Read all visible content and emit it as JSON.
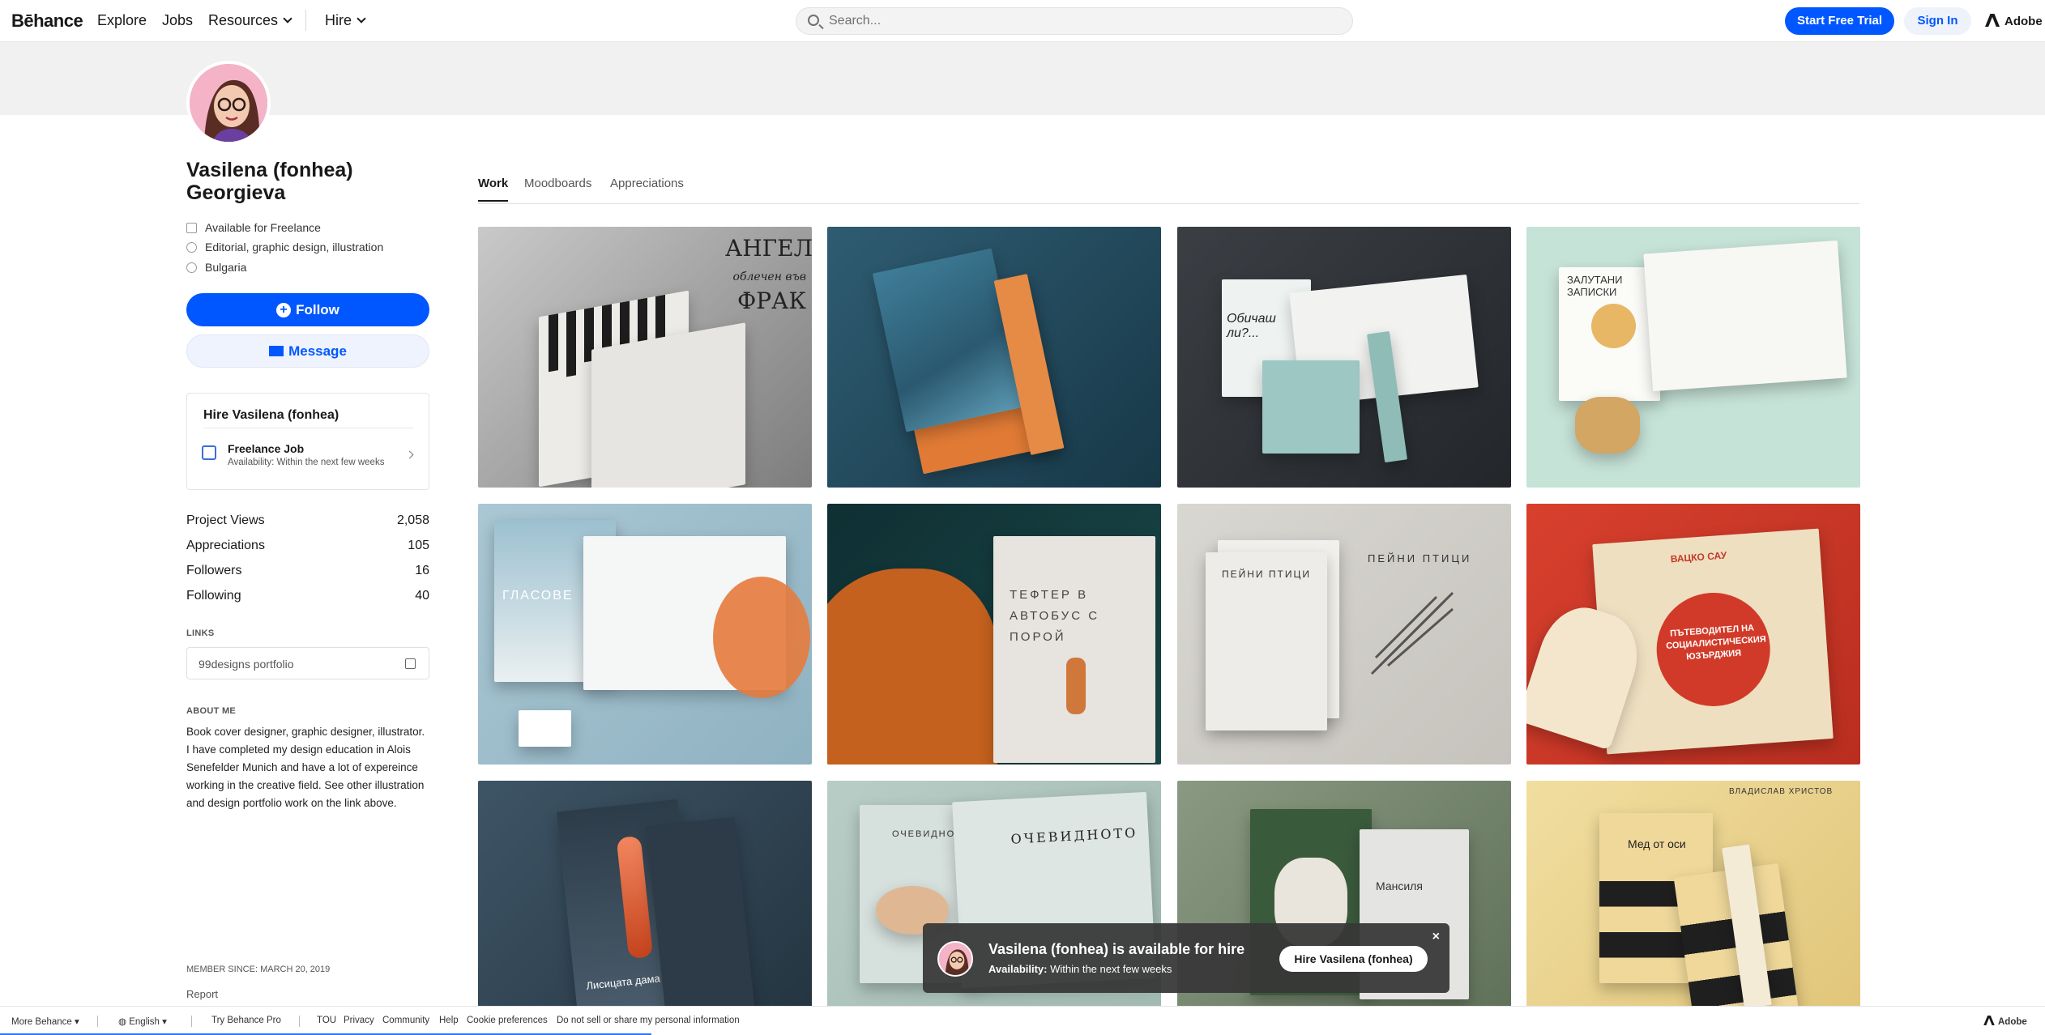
{
  "nav": {
    "logo": "Bēhance",
    "explore": "Explore",
    "jobs": "Jobs",
    "resources": "Resources",
    "hire": "Hire",
    "search_placeholder": "Search...",
    "start_trial": "Start Free Trial",
    "sign_in": "Sign In",
    "adobe": "Adobe"
  },
  "profile": {
    "name": "Vasilena (fonhea) Georgieva",
    "availability": "Available for Freelance",
    "fields": "Editorial, graphic design, illustration",
    "location": "Bulgaria",
    "follow": "Follow",
    "message": "Message"
  },
  "hire_card": {
    "title": "Hire Vasilena (fonhea)",
    "option_title": "Freelance Job",
    "option_sub": "Availability: Within the next few weeks"
  },
  "stats": [
    {
      "label": "Project Views",
      "value": "2,058"
    },
    {
      "label": "Appreciations",
      "value": "105"
    },
    {
      "label": "Followers",
      "value": "16"
    },
    {
      "label": "Following",
      "value": "40"
    }
  ],
  "links": {
    "heading": "LINKS",
    "item": "99designs portfolio"
  },
  "about": {
    "heading": "ABOUT ME",
    "text": "Book cover designer, graphic designer, illustrator. I have completed my design education in Alois Senefelder Munich and have a lot of expereince working in the creative field. See other illustration and design portfolio work on the link above."
  },
  "member_since": "MEMBER SINCE: MARCH 20, 2019",
  "report": "Report",
  "tabs": [
    "Work",
    "Moodboards",
    "Appreciations"
  ],
  "covers": {
    "t1": "АНГЕЛ",
    "t1b": "облечен във",
    "t1c": "ФРАК",
    "t3": "Обичаш ли?...",
    "t4": "ЗАЛУТАНИ ЗАПИСКИ",
    "t5": "ГЛАСОВЕ",
    "t6": "ТЕФТЕР В АВТОБУС С ПОРОЙ",
    "t7": "ПЕЙНИ ПТИЦИ",
    "t8a": "ВАЦКО САУ",
    "t8b": "ПЪТЕВОДИТЕЛ НА СОЦИАЛИСТИЧЕСКИЯ ЮЗЪРДЖИЯ",
    "t9": "Лисицата дама",
    "t10": "ОЧЕВИДНОТО",
    "t11": "Мансиля",
    "t12": "Мед от оси",
    "t12b": "ВЛАДИСЛАВ ХРИСТОВ"
  },
  "toast": {
    "title": "Vasilena (fonhea) is available for hire",
    "avail_label": "Availability:",
    "avail_value": "Within the next few weeks",
    "button": "Hire Vasilena (fonhea)",
    "close": "×"
  },
  "footer": {
    "more": "More Behance",
    "language": "English",
    "pro": "Try Behance Pro",
    "tou": "TOU",
    "privacy": "Privacy",
    "community": "Community",
    "help": "Help",
    "cookies": "Cookie preferences",
    "dnsell": "Do not sell or share my personal information",
    "adobe": "Adobe"
  },
  "colors": {
    "accent": "#0057ff",
    "text": "#191919"
  }
}
